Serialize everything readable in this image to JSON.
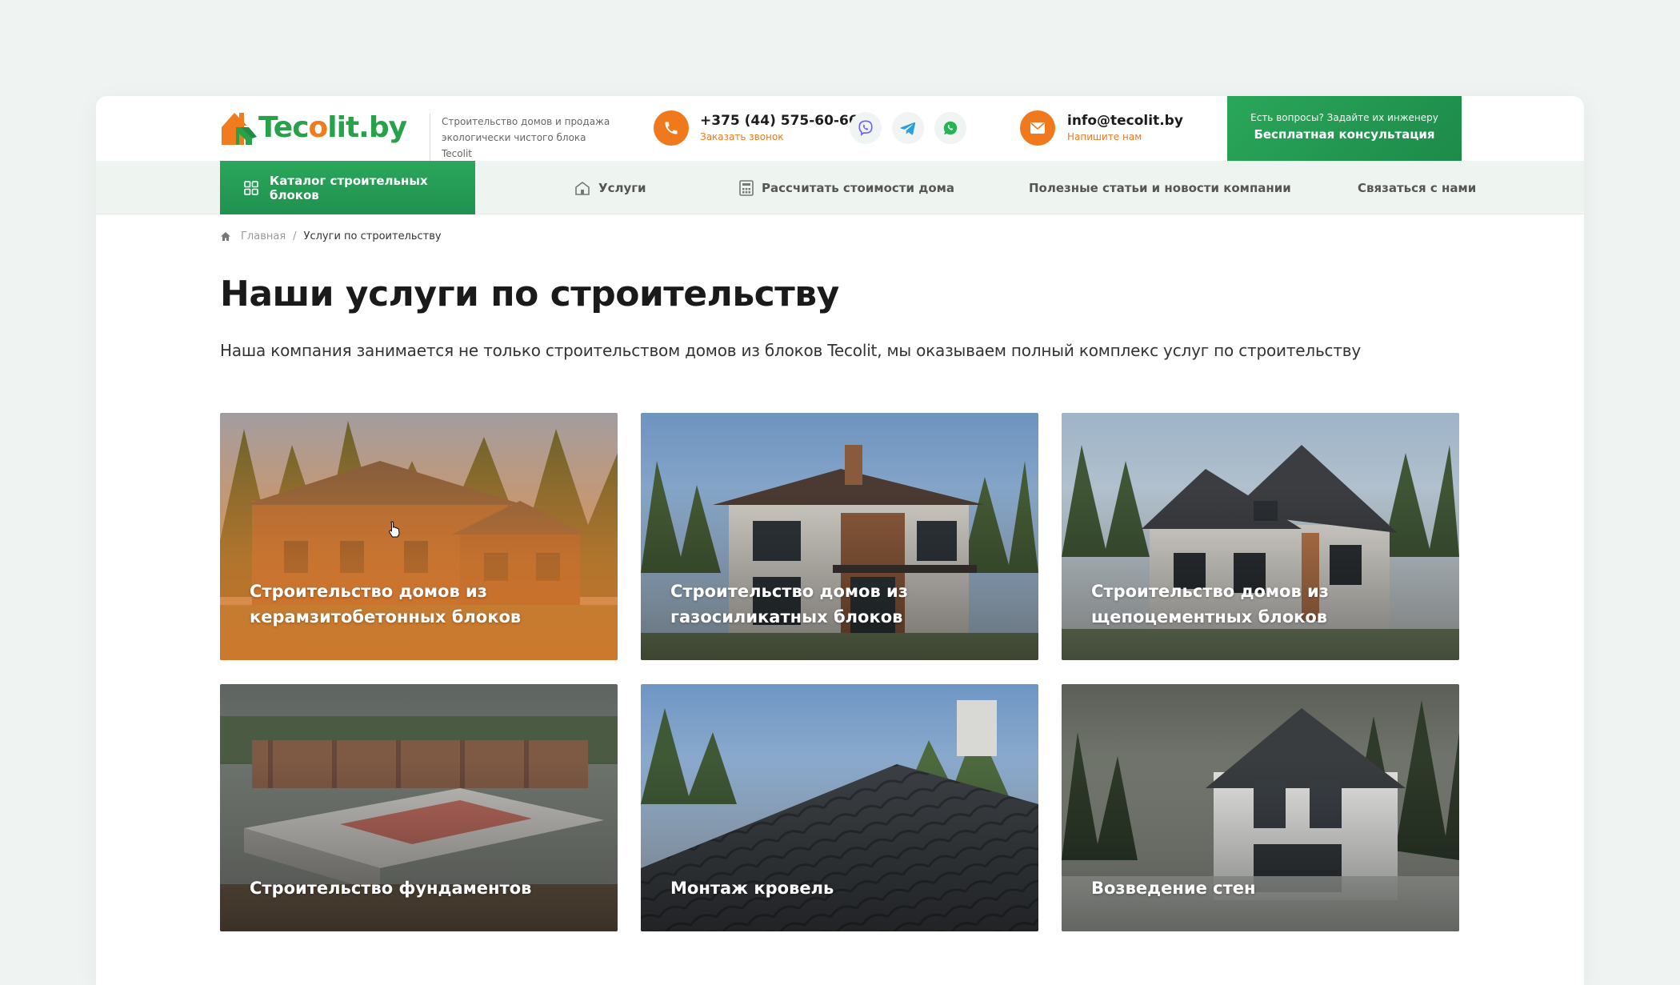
{
  "header": {
    "logo_text_1": "Tec",
    "logo_text_2": "o",
    "logo_text_3": "lit.by",
    "tagline": "Строительство домов и продажа экологически чистого блока Tecolit",
    "phone": "+375 (44) 575-60-66",
    "phone_sub": "Заказать звонок",
    "email": "info@tecolit.by",
    "email_sub": "Напишите нам",
    "consult_sub": "Есть вопросы? Задайте их инженеру",
    "consult_main": "Бесплатная консультация",
    "socials": [
      "viber-icon",
      "telegram-icon",
      "whatsapp-icon"
    ]
  },
  "nav": {
    "catalog": "Каталог строительных блоков",
    "services": "Услуги",
    "calculate": "Рассчитать стоимости дома",
    "articles": "Полезные статьи и новости компании",
    "contact": "Связаться с нами"
  },
  "breadcrumb": {
    "home": "Главная",
    "separator": "/",
    "current": "Услуги по строительству"
  },
  "page": {
    "title": "Наши услуги по строительству",
    "intro": "Наша компания занимается не только строительством домов из блоков Tecolit, мы оказываем полный комплекс услуг по строительству"
  },
  "services": [
    {
      "label": "Строительство домов из керамзитобетонных блоков"
    },
    {
      "label": "Строительство домов из газосиликатных блоков"
    },
    {
      "label": "Строительство домов из щепоцементных блоков"
    },
    {
      "label": "Строительство фундаментов"
    },
    {
      "label": "Монтаж кровель"
    },
    {
      "label": "Возведение стен"
    }
  ],
  "colors": {
    "brand_green": "#27a24b",
    "brand_orange": "#f07c1f",
    "nav_bg": "#eef5f1"
  }
}
